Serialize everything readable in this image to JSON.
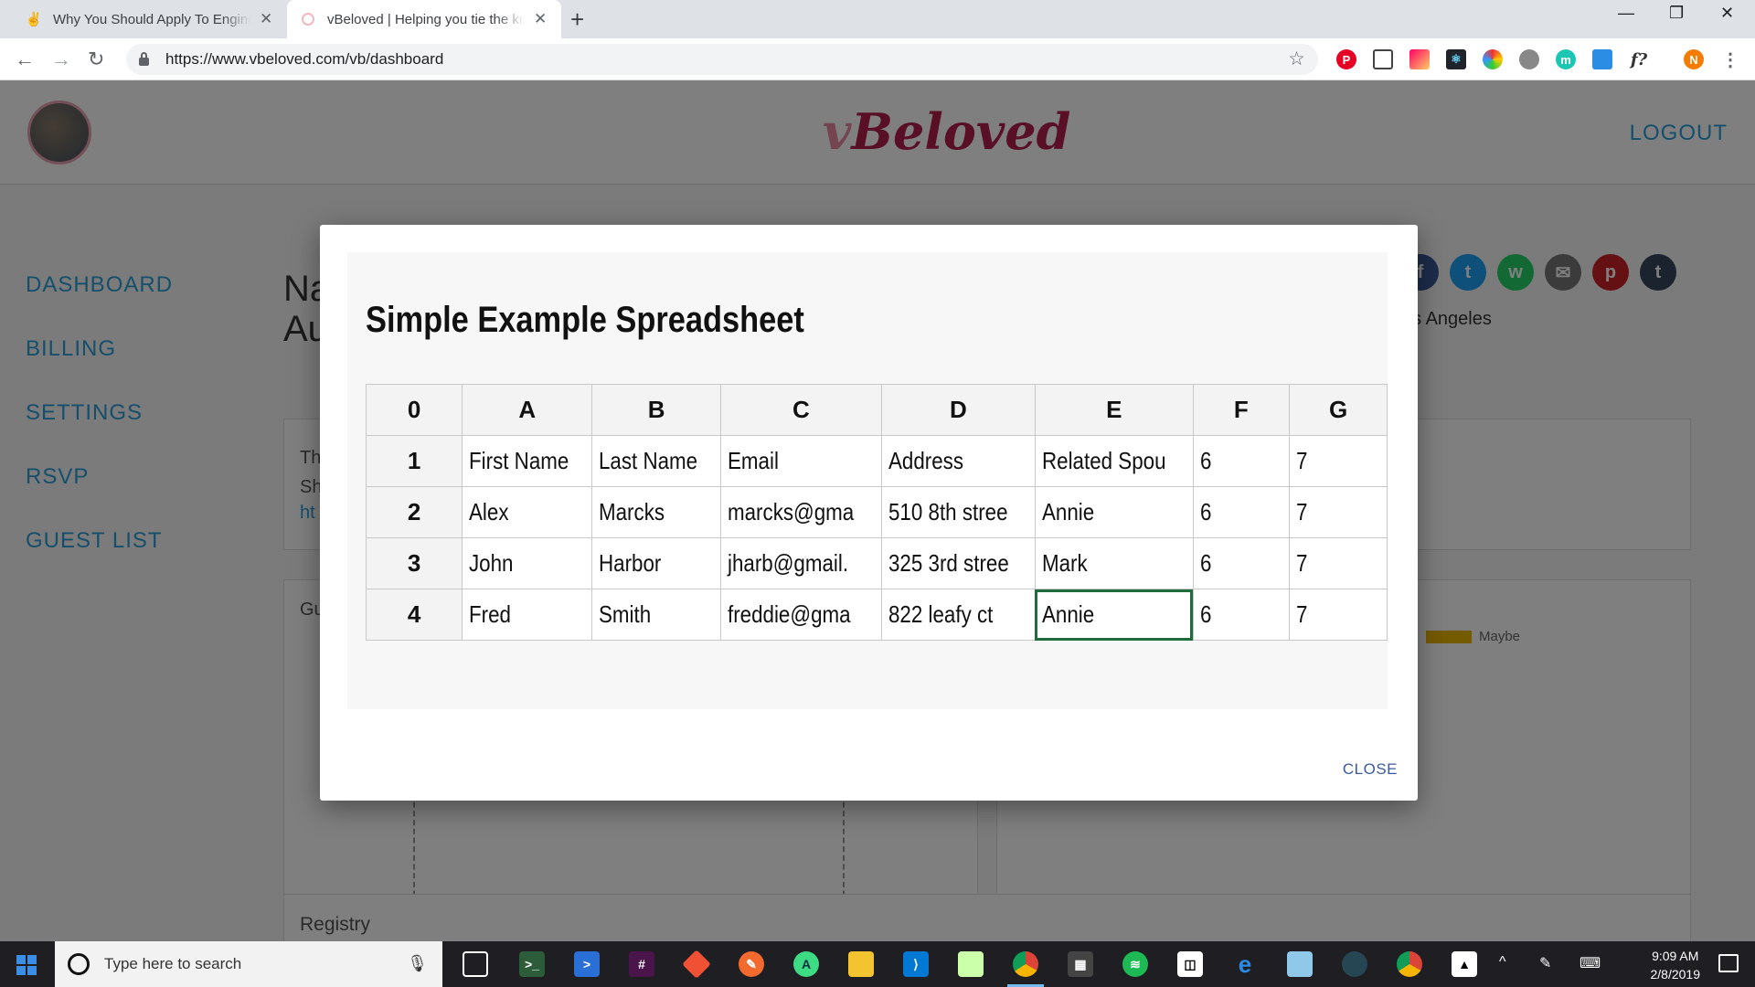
{
  "browser": {
    "tabs": [
      {
        "title": "Why You Should Apply To Engineering",
        "close": "✕"
      },
      {
        "title": "vBeloved | Helping you tie the knot",
        "close": "✕"
      }
    ],
    "new_tab": "+",
    "url": "https://www.vbeloved.com/vb/dashboard",
    "profile_initial": "N"
  },
  "site": {
    "brand_prefix": "v",
    "brand_rest": "Beloved",
    "logout": "LOGOUT",
    "nav": [
      "DASHBOARD",
      "BILLING",
      "SETTINGS",
      "RSVP",
      "GUEST LIST"
    ],
    "page_title_fragment_1": "Na",
    "page_title_fragment_2": "Au",
    "card_fragments": [
      "Th",
      "Sh",
      "ht"
    ],
    "guest_fragment": "Gu",
    "city_fragment": "os Angeles",
    "legend_maybe": "Maybe",
    "registry": "Registry",
    "colors": {
      "brand": "#b31f4a",
      "nav": "#2a9fd6"
    }
  },
  "modal": {
    "title": "Simple Example Spreadsheet",
    "grid": [
      [
        "0",
        "A",
        "B",
        "C",
        "D",
        "E",
        "F",
        "G"
      ],
      [
        "1",
        "First Name",
        "Last Name",
        "Email",
        "Address",
        "Related Spou",
        "6",
        "7"
      ],
      [
        "2",
        "Alex",
        "Marcks",
        "marcks@gma",
        "510 8th stree",
        "Annie",
        "6",
        "7"
      ],
      [
        "3",
        "John",
        "Harbor",
        "jharb@gmail.",
        "325 3rd stree",
        "Mark",
        "6",
        "7"
      ],
      [
        "4",
        "Fred",
        "Smith",
        "freddie@gma",
        "822 leafy ct",
        "Annie",
        "6",
        "7"
      ]
    ],
    "close": "CLOSE",
    "selection_color": "#1e6b3c"
  },
  "taskbar": {
    "search_placeholder": "Type here to search",
    "time": "9:09 AM",
    "date": "2/8/2019"
  }
}
